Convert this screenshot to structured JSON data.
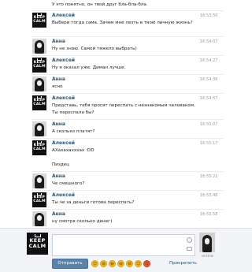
{
  "messages": [
    {
      "type": "continuation",
      "text": "У это понятно, он твой друг бла-бла-бла."
    },
    {
      "type": "message",
      "sender": "Алексей",
      "avatar": "keep-calm",
      "time": "16:53:50",
      "lines": [
        "Выбери тогда сама. Зачем мне лезть в твою личную жизнь?"
      ]
    },
    {
      "type": "message",
      "sender": "Анна",
      "avatar": "photo",
      "time": "16:54:07",
      "lines": [
        "Ну не знаю. Самой тяжело выбрать)"
      ]
    },
    {
      "type": "message",
      "sender": "Алексей",
      "avatar": "keep-calm",
      "time": "16:54:27",
      "lines": [
        "Ну я оказал уже. Диман лучше."
      ]
    },
    {
      "type": "message",
      "sender": "Анна",
      "avatar": "photo",
      "time": "16:54:36",
      "lines": [
        "ясно"
      ]
    },
    {
      "type": "message",
      "sender": "Алексей",
      "avatar": "keep-calm",
      "time": "16:54:57",
      "lines": [
        "Представь, тебя просят переспать с незнакомым человеком. Ты переспала бы?"
      ]
    },
    {
      "type": "message",
      "sender": "Анна",
      "avatar": "photo",
      "time": "16:55:07",
      "lines": [
        "А сколько платят?"
      ]
    },
    {
      "type": "message",
      "sender": "Алексей",
      "avatar": "keep-calm",
      "time": "16:55:17",
      "lines": [
        "АХахахахххах :DD",
        "",
        "Пиздец"
      ]
    },
    {
      "type": "message",
      "sender": "Анна",
      "avatar": "photo",
      "time": "16:55:21",
      "lines": [
        "Че смешного?"
      ]
    },
    {
      "type": "message",
      "sender": "Алексей",
      "avatar": "keep-calm",
      "time": "16:55:46",
      "lines": [
        "Ты че за деньги готова переспать?"
      ]
    },
    {
      "type": "message",
      "sender": "Анна",
      "avatar": "photo",
      "time": "16:55:58",
      "lines": [
        "ну смотря сколько денег)"
      ]
    }
  ],
  "avatar_text": [
    "KEEP",
    "CALM"
  ],
  "composer": {
    "send_label": "Отправить",
    "attach_label": "Прикрепить",
    "status": "online",
    "emoji": [
      "😊",
      "😄",
      "😀",
      "😃",
      "😆",
      "😉",
      "😡"
    ]
  },
  "colors": {
    "name_link": "#2b587a",
    "send_button": "#5e81a8",
    "composer_bg": "#f2f4f7"
  }
}
